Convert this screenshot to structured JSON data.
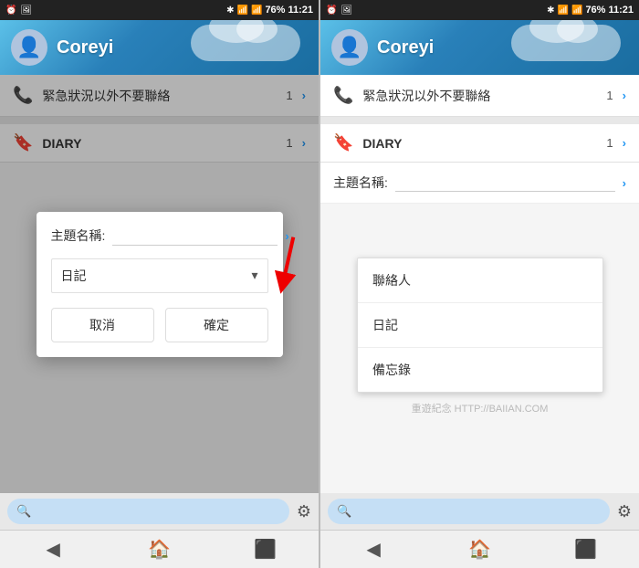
{
  "panel_left": {
    "status_bar": {
      "time": "11:21",
      "battery": "76%",
      "icons": [
        "alarm",
        "image",
        "bluetooth",
        "wifi",
        "signal"
      ]
    },
    "header": {
      "username": "Coreyi",
      "avatar_label": "👤"
    },
    "list_items": [
      {
        "icon": "📞",
        "text": "緊急狀況以外不要聯絡",
        "badge": "1",
        "arrow": ">"
      }
    ],
    "diary": {
      "icon": "🔖",
      "title": "DIARY",
      "badge": "1",
      "arrow": ">"
    },
    "dialog": {
      "label_theme": "主題名稱:",
      "input_placeholder": "",
      "select_value": "日記",
      "select_arrow": "▾",
      "btn_cancel": "取消",
      "btn_confirm": "確定"
    },
    "bottom_bar": {
      "search_placeholder": "",
      "settings_icon": "⚙"
    },
    "nav": {
      "back": "◀",
      "home": "🏠",
      "recent": "⬛"
    }
  },
  "panel_right": {
    "status_bar": {
      "time": "11:21",
      "battery": "76%"
    },
    "header": {
      "username": "Coreyi",
      "avatar_label": "👤"
    },
    "list_items": [
      {
        "icon": "📞",
        "text": "緊急狀況以外不要聯絡",
        "badge": "1",
        "arrow": ">"
      }
    ],
    "diary": {
      "icon": "🔖",
      "title": "DIARY",
      "badge": "1",
      "arrow": ">"
    },
    "dialog": {
      "label_theme": "主題名稱:",
      "input_placeholder": ""
    },
    "dropdown": {
      "items": [
        "聯絡人",
        "日記",
        "備忘錄"
      ]
    },
    "watermark": "重遊紀念 HTTP://BAIIAN.COM",
    "bottom_bar": {
      "settings_icon": "⚙"
    },
    "nav": {
      "back": "◀",
      "home": "🏠",
      "recent": "⬛"
    }
  }
}
